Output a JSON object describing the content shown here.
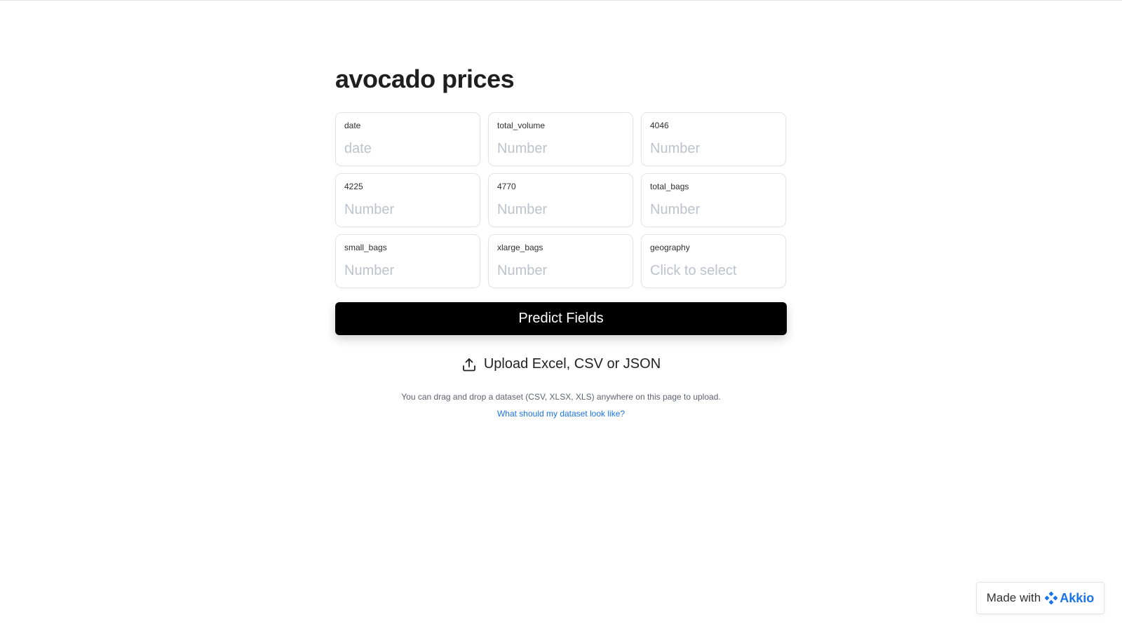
{
  "page": {
    "title": "avocado prices"
  },
  "fields": [
    {
      "label": "date",
      "placeholder": "date",
      "type": "text"
    },
    {
      "label": "total_volume",
      "placeholder": "Number",
      "type": "number"
    },
    {
      "label": "4046",
      "placeholder": "Number",
      "type": "number"
    },
    {
      "label": "4225",
      "placeholder": "Number",
      "type": "number"
    },
    {
      "label": "4770",
      "placeholder": "Number",
      "type": "number"
    },
    {
      "label": "total_bags",
      "placeholder": "Number",
      "type": "number"
    },
    {
      "label": "small_bags",
      "placeholder": "Number",
      "type": "number"
    },
    {
      "label": "xlarge_bags",
      "placeholder": "Number",
      "type": "number"
    },
    {
      "label": "geography",
      "placeholder": "Click to select",
      "type": "select"
    }
  ],
  "actions": {
    "predict_label": "Predict Fields",
    "upload_label": "Upload Excel, CSV or JSON",
    "upload_icon": "upload-icon"
  },
  "hint": {
    "text": "You can drag and drop a dataset (CSV, XLSX, XLS) anywhere on this page to upload.",
    "link_text": "What should my dataset look like?"
  },
  "badge": {
    "prefix": "Made with",
    "brand": "Akkio",
    "brand_icon": "akkio-logo-icon",
    "brand_color": "#1a73e8"
  },
  "colors": {
    "accent": "#1a73e8",
    "button_bg": "#000000",
    "placeholder": "#bcc3cc"
  }
}
